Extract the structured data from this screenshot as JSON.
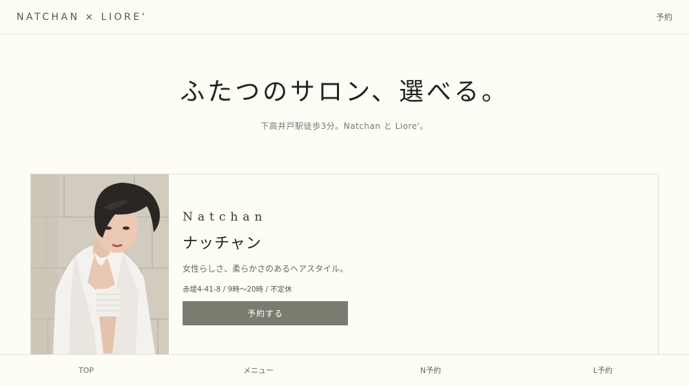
{
  "header": {
    "brand": "NATCHAN × LIORE'",
    "reserve_link": "予約"
  },
  "hero": {
    "title": "ふたつのサロン、選べる。",
    "subtitle": "下高井戸駅徒歩3分。Natchan と Liore'。"
  },
  "salon_card": {
    "name_en": "Natchan",
    "name_ja": "ナッチャン",
    "description": "女性らしさ、柔らかさのあるヘアスタイル。",
    "info": "赤堤4-41-8 / 9時〜20時 / 不定休",
    "button_label": "予約する"
  },
  "bottom_nav": {
    "items": [
      {
        "label": "TOP"
      },
      {
        "label": "メニュー"
      },
      {
        "label": "N予約"
      },
      {
        "label": "L予約"
      }
    ]
  },
  "colors": {
    "background": "#fdfdf5",
    "button": "#7b7b6f",
    "text": "#333333"
  }
}
